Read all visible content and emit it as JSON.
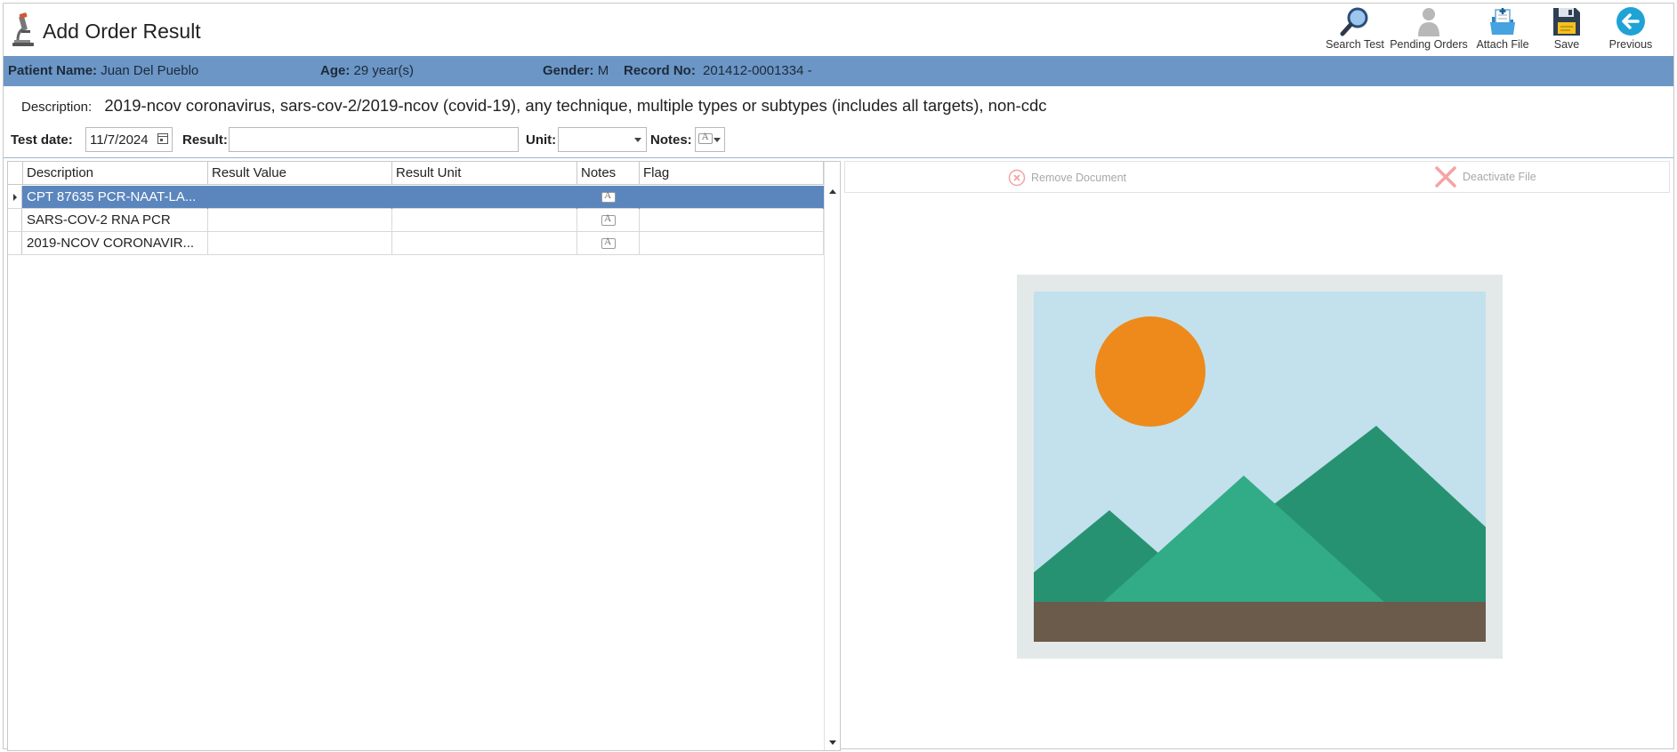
{
  "header": {
    "title": "Add Order Result",
    "toolbar": [
      {
        "name": "search-test-button",
        "icon": "magnifier-icon",
        "label": "Search Test"
      },
      {
        "name": "pending-orders-button",
        "icon": "person-icon",
        "label": "Pending Orders"
      },
      {
        "name": "attach-file-button",
        "icon": "attach-file-icon",
        "label": "Attach File"
      },
      {
        "name": "save-button",
        "icon": "floppy-disk-icon",
        "label": "Save"
      },
      {
        "name": "previous-button",
        "icon": "back-arrow-icon",
        "label": "Previous"
      }
    ]
  },
  "patient": {
    "name_label": "Patient Name:",
    "name": "Juan Del Pueblo",
    "age_label": "Age:",
    "age": "29 year(s)",
    "gender_label": "Gender:",
    "gender": "M",
    "record_label": "Record No:",
    "record": "201412-0001334 -"
  },
  "description": {
    "label": "Description:",
    "value": "2019-ncov coronavirus, sars-cov-2/2019-ncov (covid-19), any technique, multiple types or subtypes (includes all targets), non-cdc"
  },
  "form": {
    "test_date_label": "Test date:",
    "test_date": "11/7/2024",
    "result_label": "Result:",
    "result_value": "",
    "unit_label": "Unit:",
    "unit_value": "",
    "notes_label": "Notes:"
  },
  "grid": {
    "columns": [
      "Description",
      "Result Value",
      "Result Unit",
      "Notes",
      "Flag"
    ],
    "rows": [
      {
        "description": "CPT 87635 PCR-NAAT-LA...",
        "result_value": "",
        "result_unit": "",
        "flag": "",
        "selected": true
      },
      {
        "description": "SARS-COV-2 RNA PCR",
        "result_value": "",
        "result_unit": "",
        "flag": "",
        "selected": false
      },
      {
        "description": "2019-NCOV CORONAVIR...",
        "result_value": "",
        "result_unit": "",
        "flag": "",
        "selected": false
      }
    ]
  },
  "documents": {
    "remove_label": "Remove Document",
    "deactivate_label": "Deactivate File",
    "preview_icon": "image-placeholder-icon"
  },
  "colors": {
    "patient_bar": "#6b96c6",
    "selected_row": "#5b86bd",
    "accent_blue": "#1fa3d6"
  }
}
